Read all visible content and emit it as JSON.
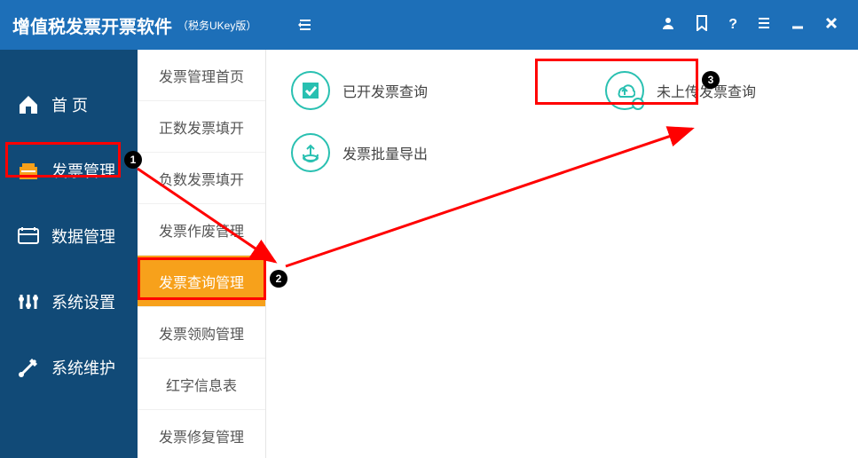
{
  "app": {
    "title": "增值税发票开票软件",
    "subtitle": "（税务UKey版）"
  },
  "sidebar1": {
    "items": [
      {
        "label": "首 页",
        "icon": "home-icon"
      },
      {
        "label": "发票管理",
        "icon": "invoice-icon"
      },
      {
        "label": "数据管理",
        "icon": "data-icon"
      },
      {
        "label": "系统设置",
        "icon": "settings-icon"
      },
      {
        "label": "系统维护",
        "icon": "maintain-icon"
      }
    ],
    "activeIndex": 1
  },
  "sidebar2": {
    "items": [
      {
        "label": "发票管理首页"
      },
      {
        "label": "正数发票填开"
      },
      {
        "label": "负数发票填开"
      },
      {
        "label": "发票作废管理"
      },
      {
        "label": "发票查询管理"
      },
      {
        "label": "发票领购管理"
      },
      {
        "label": "红字信息表"
      },
      {
        "label": "发票修复管理"
      }
    ],
    "activeIndex": 4
  },
  "main": {
    "tiles": [
      {
        "label": "已开发票查询",
        "icon": "check-icon"
      },
      {
        "label": "未上传发票查询",
        "icon": "cloud-upload-icon"
      },
      {
        "label": "发票批量导出",
        "icon": "export-icon"
      }
    ]
  },
  "annotations": {
    "badges": [
      "1",
      "2",
      "3"
    ]
  },
  "colors": {
    "headerBg": "#1d6fb8",
    "sidebarBg": "#114a77",
    "activeSubmenuBg": "#f7a11b",
    "tileIconBorder": "#29c0b1",
    "annotation": "#ff0000"
  }
}
